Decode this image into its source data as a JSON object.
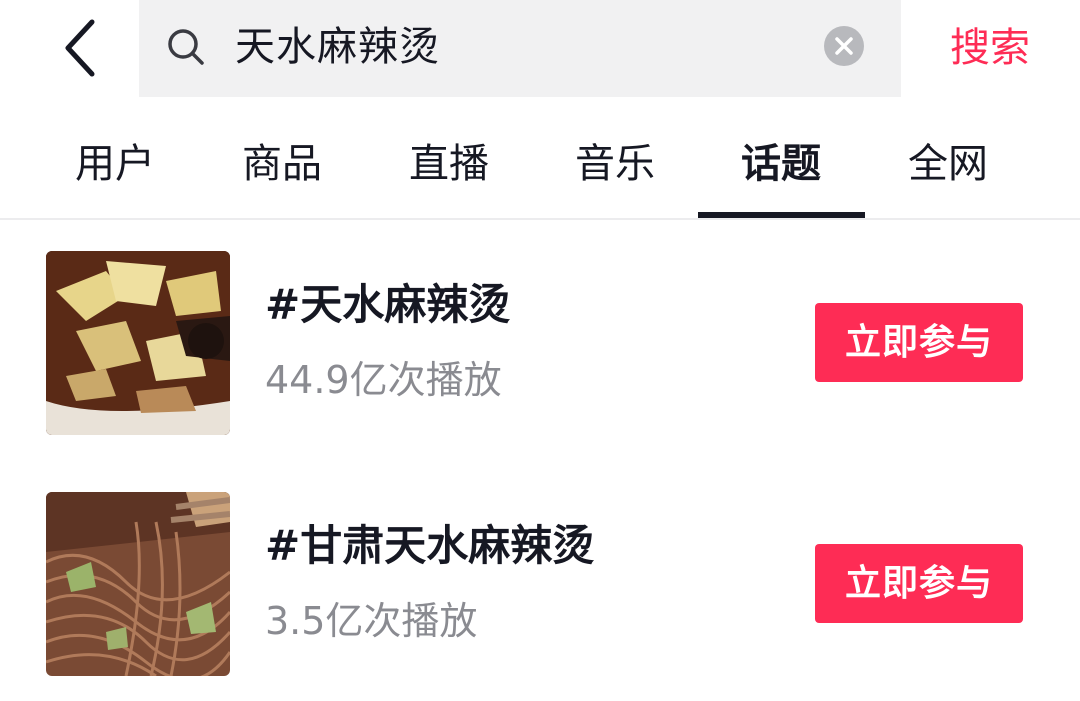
{
  "search": {
    "query": "天水麻辣烫",
    "action_label": "搜索"
  },
  "tabs": [
    {
      "label": "用户"
    },
    {
      "label": "商品"
    },
    {
      "label": "直播"
    },
    {
      "label": "音乐"
    },
    {
      "label": "话题",
      "active": true
    },
    {
      "label": "全网"
    }
  ],
  "topics": [
    {
      "title": "#天水麻辣烫",
      "plays": "44.9亿次播放",
      "button": "立即参与",
      "thumb_icon": "food-thumbnail-wide-noodles"
    },
    {
      "title": "#甘肃天水麻辣烫",
      "plays": "3.5亿次播放",
      "button": "立即参与",
      "thumb_icon": "food-thumbnail-thin-noodles"
    }
  ],
  "colors": {
    "accent": "#fe2c55",
    "text_primary": "#161823",
    "text_secondary": "#8a8b91",
    "search_bg": "#f1f1f2"
  }
}
